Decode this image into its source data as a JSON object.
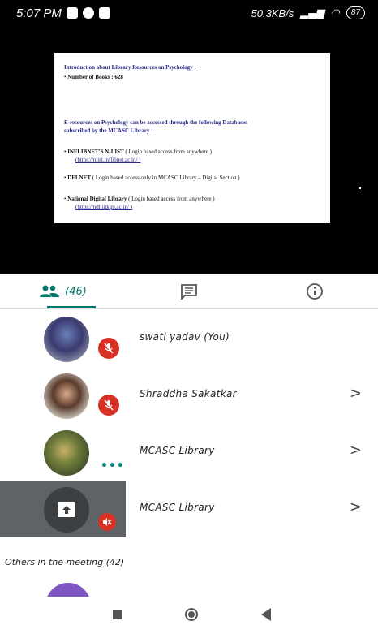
{
  "status_bar": {
    "time": "5:07 PM",
    "network_speed": "50.3KB/s",
    "battery": "87"
  },
  "slide": {
    "heading": "Introduction about Library Resources on Psychology :",
    "books_label": "Number of Books : 628",
    "eresources_line1": "E-resources on Psychology can be accessed through the following Databases",
    "eresources_line2": "subscribed by the MCASC Library :",
    "items": [
      {
        "name": "INFLIBNET'S N-LIST",
        "desc": "( Login based access from anywhere )",
        "link": "(https://nlist.inflibnet.ac.in/ )"
      },
      {
        "name": "DELNET",
        "desc": "( Login based access only in MCASC Library – Digital Section )",
        "link": ""
      },
      {
        "name": "National Digital Library",
        "desc": "( Login based access from anywhere )",
        "link": "(https://ndl.iitkgp.ac.in/ )"
      }
    ]
  },
  "tabs": {
    "people_count": "(46)"
  },
  "participants": [
    {
      "name": "swati yadav (You)",
      "muted": true,
      "chevron": ""
    },
    {
      "name": "Shraddha Sakatkar",
      "muted": true,
      "chevron": ">"
    },
    {
      "name": "MCASC Library",
      "muted": false,
      "chevron": ">"
    },
    {
      "name": "MCASC Library",
      "muted": true,
      "chevron": ">"
    }
  ],
  "others_label": "Others in the meeting (42)",
  "colors": {
    "accent": "#00796b",
    "muted_red": "#d93025",
    "presenter_bg": "#5f6368"
  }
}
